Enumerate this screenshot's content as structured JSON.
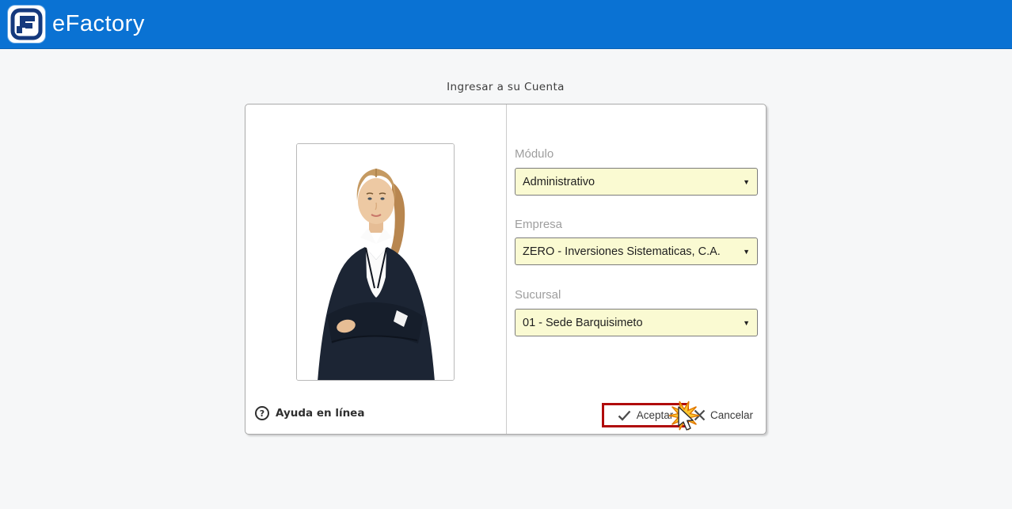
{
  "header": {
    "app_name": "eFactory"
  },
  "page": {
    "title": "Ingresar a su Cuenta"
  },
  "login": {
    "help_label": "Ayuda en línea",
    "fields": {
      "modulo": {
        "label": "Módulo",
        "value": "Administrativo"
      },
      "empresa": {
        "label": "Empresa",
        "value": "ZERO - Inversiones Sistematicas, C.A."
      },
      "sucursal": {
        "label": "Sucursal",
        "value": "01 - Sede Barquisimeto"
      }
    },
    "actions": {
      "accept": "Aceptar",
      "cancel": "Cancelar"
    }
  },
  "icons": {
    "dropdown_arrow": "▼",
    "question_mark": "?",
    "logo_icon": "efactory-f-icon",
    "accept_icon": "check-icon",
    "cancel_icon": "x-icon",
    "click_effect": "cursor-click-starburst"
  },
  "colors": {
    "header_blue": "#0a72d3",
    "logo_navy": "#15397d",
    "select_background": "#fafad2",
    "accept_highlight_red": "#b00b0b",
    "label_gray": "#9e9e9e",
    "starburst_yellow": "#fdc62e"
  }
}
